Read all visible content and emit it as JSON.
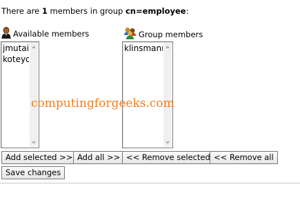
{
  "summary": {
    "prefix": "There are ",
    "count": "1",
    "middle": " members in group ",
    "group": "cn=employee",
    "suffix": ":"
  },
  "available": {
    "heading": "Available members",
    "icon": "user-icon",
    "items": [
      "jmutai",
      "koteyo"
    ]
  },
  "group": {
    "heading": "Group members",
    "icon": "group-icon",
    "items": [
      "klinsmann"
    ]
  },
  "watermark": "computingforgeeks.com",
  "buttons": {
    "add_selected": "Add selected >>",
    "add_all": "Add all >>",
    "remove_selected": "<< Remove selected",
    "remove_all": "<< Remove all",
    "save": "Save changes"
  },
  "colors": {
    "watermark": "#f07d1a"
  }
}
